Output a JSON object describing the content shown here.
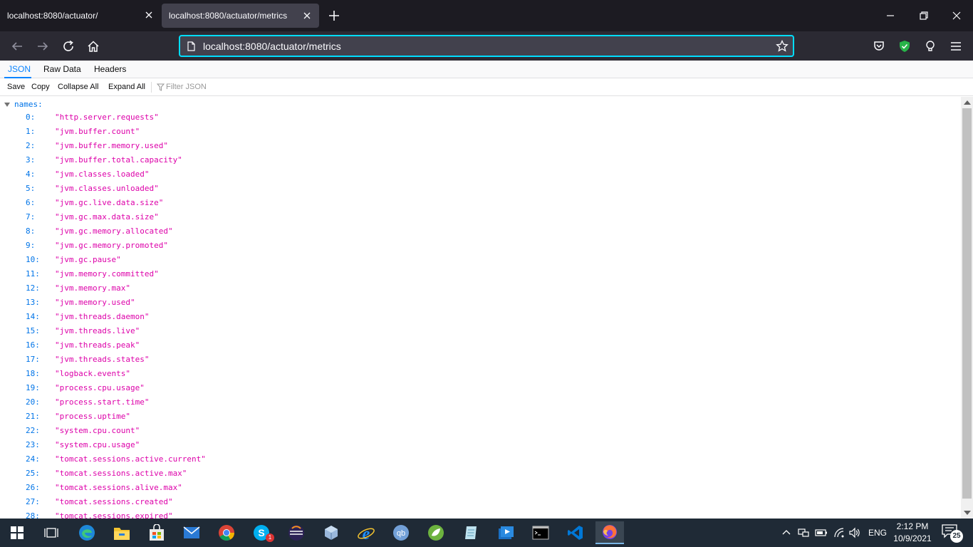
{
  "browser": {
    "tabs": [
      {
        "title": "localhost:8080/actuator/",
        "active": false
      },
      {
        "title": "localhost:8080/actuator/metrics",
        "active": true
      }
    ],
    "url": "localhost:8080/actuator/metrics"
  },
  "viewer": {
    "tabs": [
      "JSON",
      "Raw Data",
      "Headers"
    ],
    "toolbar": {
      "save": "Save",
      "copy": "Copy",
      "collapse_all": "Collapse All",
      "expand_all": "Expand All",
      "filter_placeholder": "Filter JSON"
    },
    "root_key": "names:",
    "entries": [
      {
        "key": "0:",
        "value": "\"http.server.requests\""
      },
      {
        "key": "1:",
        "value": "\"jvm.buffer.count\""
      },
      {
        "key": "2:",
        "value": "\"jvm.buffer.memory.used\""
      },
      {
        "key": "3:",
        "value": "\"jvm.buffer.total.capacity\""
      },
      {
        "key": "4:",
        "value": "\"jvm.classes.loaded\""
      },
      {
        "key": "5:",
        "value": "\"jvm.classes.unloaded\""
      },
      {
        "key": "6:",
        "value": "\"jvm.gc.live.data.size\""
      },
      {
        "key": "7:",
        "value": "\"jvm.gc.max.data.size\""
      },
      {
        "key": "8:",
        "value": "\"jvm.gc.memory.allocated\""
      },
      {
        "key": "9:",
        "value": "\"jvm.gc.memory.promoted\""
      },
      {
        "key": "10:",
        "value": "\"jvm.gc.pause\""
      },
      {
        "key": "11:",
        "value": "\"jvm.memory.committed\""
      },
      {
        "key": "12:",
        "value": "\"jvm.memory.max\""
      },
      {
        "key": "13:",
        "value": "\"jvm.memory.used\""
      },
      {
        "key": "14:",
        "value": "\"jvm.threads.daemon\""
      },
      {
        "key": "15:",
        "value": "\"jvm.threads.live\""
      },
      {
        "key": "16:",
        "value": "\"jvm.threads.peak\""
      },
      {
        "key": "17:",
        "value": "\"jvm.threads.states\""
      },
      {
        "key": "18:",
        "value": "\"logback.events\""
      },
      {
        "key": "19:",
        "value": "\"process.cpu.usage\""
      },
      {
        "key": "20:",
        "value": "\"process.start.time\""
      },
      {
        "key": "21:",
        "value": "\"process.uptime\""
      },
      {
        "key": "22:",
        "value": "\"system.cpu.count\""
      },
      {
        "key": "23:",
        "value": "\"system.cpu.usage\""
      },
      {
        "key": "24:",
        "value": "\"tomcat.sessions.active.current\""
      },
      {
        "key": "25:",
        "value": "\"tomcat.sessions.active.max\""
      },
      {
        "key": "26:",
        "value": "\"tomcat.sessions.alive.max\""
      },
      {
        "key": "27:",
        "value": "\"tomcat.sessions.created\""
      },
      {
        "key": "28:",
        "value": "\"tomcat.sessions.expired\""
      }
    ]
  },
  "taskbar": {
    "apps": [
      "windows-start-icon",
      "task-view-icon",
      "edge-icon",
      "file-explorer-icon",
      "store-icon",
      "mail-icon",
      "chrome-icon",
      "skype-icon",
      "eclipse-icon",
      "virtualbox-icon",
      "internet-explorer-icon",
      "qbittorrent-icon",
      "spring-tools-icon",
      "notepad-icon",
      "media-player-icon",
      "terminal-icon",
      "vscode-icon",
      "firefox-icon"
    ],
    "qbittorrent_label": "qb",
    "skype_badge": "1",
    "language": "ENG",
    "time": "2:12 PM",
    "date": "10/9/2021",
    "notification_count": "25"
  },
  "colors": {
    "accent": "#0a84ff",
    "key": "#0074e8",
    "string": "#dd00a9",
    "url_focus": "#00ddff",
    "taskbar": "#1f2a36"
  }
}
